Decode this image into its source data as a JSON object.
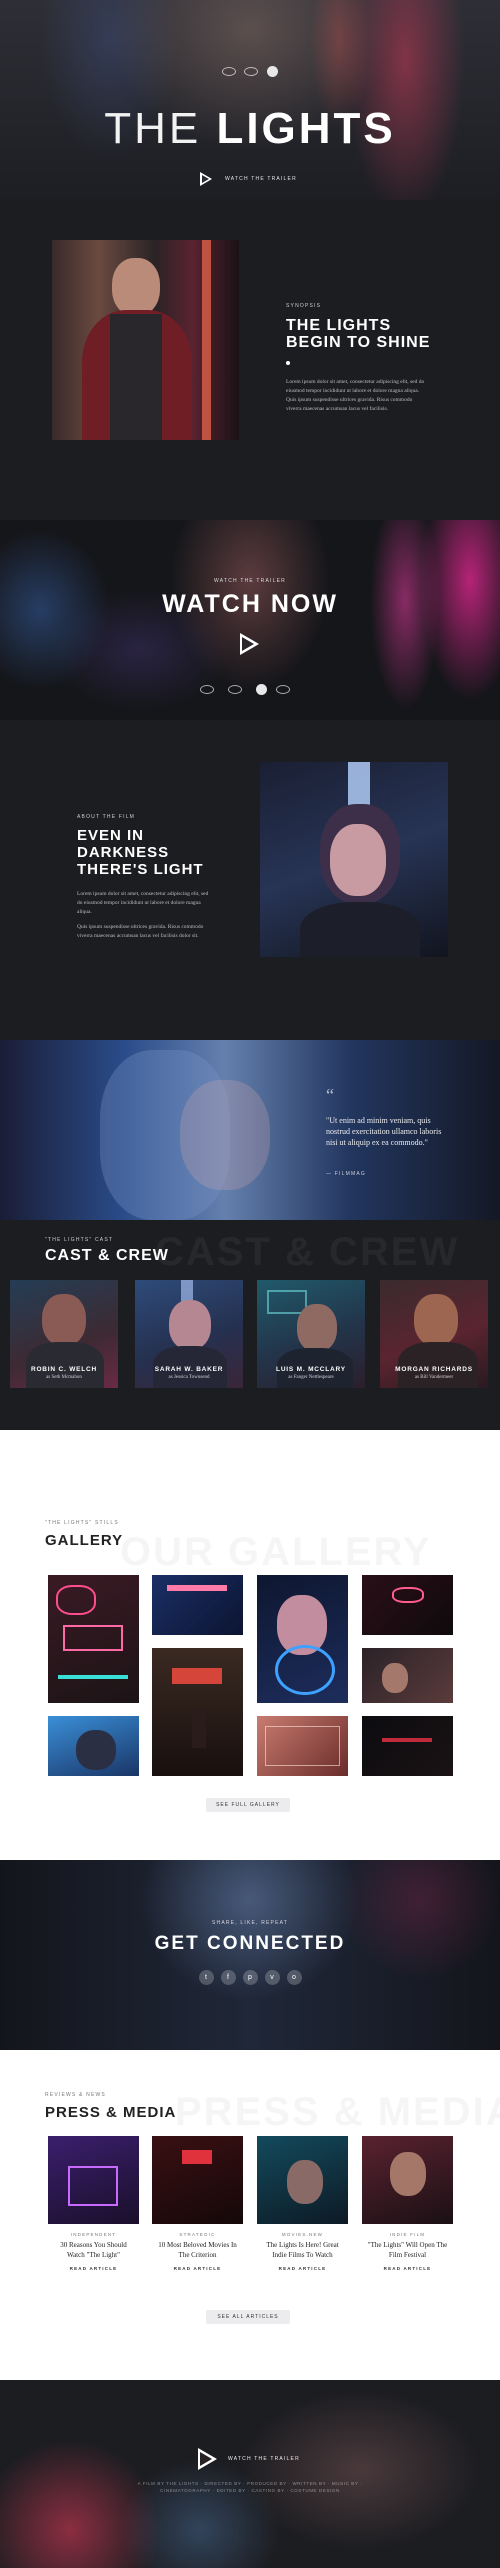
{
  "hero": {
    "title_thin": "THE",
    "title_bold": "LIGHTS",
    "trailer_label": "WATCH THE TRAILER"
  },
  "synopsis": {
    "kicker": "SYNOPSIS",
    "title_line1": "THE LIGHTS",
    "title_line2": "BEGIN TO SHINE",
    "body": "Lorem ipsum dolor sit amet, consectetur adipiscing elit, sed do eiusmod tempor incididunt ut labore et dolore magna aliqua. Quis ipsum suspendisse ultrices gravida. Risus commodo viverra maecenas accumsan lacus vel facilisis."
  },
  "watch": {
    "kicker": "WATCH THE TRAILER",
    "title": "WATCH NOW"
  },
  "about": {
    "kicker": "ABOUT THE FILM",
    "title_line1": "EVEN IN",
    "title_line2": "DARKNESS",
    "title_line3": "THERE'S LIGHT",
    "body1": "Lorem ipsum dolor sit amet, consectetur adipiscing elit, sed do eiusmod tempor incididunt ut labore et dolore magna aliqua.",
    "body2": "Quis ipsum suspendisse ultrices gravida. Risus commodo viverra maecenas accumsan lacus vel facilisis dolor sit."
  },
  "quote": {
    "text": "\"Ut enim ad minim veniam, quis nostrud exercitation ullamco laboris nisi ut aliquip ex ea commodo.\"",
    "source": "— FILMMAG"
  },
  "cast": {
    "kicker": "\"THE LIGHTS\" CAST",
    "title": "CAST & CREW",
    "ghost": "CAST & CREW",
    "members": [
      {
        "name": "ROBIN C. WELCH",
        "role": "as Seth Mcmahon"
      },
      {
        "name": "SARAH W. BAKER",
        "role": "as Jessica Townsend"
      },
      {
        "name": "LUIS M. MCCLARY",
        "role": "as Fanger Nettlespeare"
      },
      {
        "name": "MORGAN RICHARDS",
        "role": "as Bill Vandermeer"
      }
    ]
  },
  "gallery": {
    "kicker": "\"THE LIGHTS\" STILLS",
    "title": "GALLERY",
    "ghost": "OUR GALLERY",
    "button": "SEE FULL GALLERY"
  },
  "connect": {
    "kicker": "SHARE, LIKE, REPEAT",
    "title": "GET CONNECTED",
    "icons": [
      "twitter-icon",
      "facebook-icon",
      "pinterest-icon",
      "vimeo-icon",
      "instagram-icon"
    ],
    "glyphs": [
      "t",
      "f",
      "p",
      "v",
      "o"
    ]
  },
  "press": {
    "kicker": "REVIEWS & NEWS",
    "title": "PRESS & MEDIA",
    "ghost": "PRESS & MEDIA",
    "articles": [
      {
        "source": "INDEPENDENT",
        "title": "30 Reasons You Should Watch \"The Light\"",
        "link": "READ ARTICLE"
      },
      {
        "source": "STRATEGIC",
        "title": "10 Most Beloved Movies In The Criterion",
        "link": "READ ARTICLE"
      },
      {
        "source": "MOVIES.NEW",
        "title": "The Lights Is Here! Great Indie Films To Watch",
        "link": "READ ARTICLE"
      },
      {
        "source": "INDIE FILM",
        "title": "\"The Lights\" Will Open The Film Festival",
        "link": "READ ARTICLE"
      }
    ],
    "button": "SEE ALL ARTICLES"
  },
  "footer": {
    "trailer_label": "WATCH THE TRAILER",
    "credits": "A FILM BY THE LIGHTS · DIRECTED BY · PRODUCED BY · WRITTEN BY · MUSIC BY · CINEMATOGRAPHY · EDITED BY · CASTING BY · COSTUME DESIGN"
  },
  "colors": {
    "background": "#1c1d21",
    "neon_pink": "#e23a6c",
    "neon_blue": "#2e63c4",
    "light_bg": "#ffffff"
  }
}
